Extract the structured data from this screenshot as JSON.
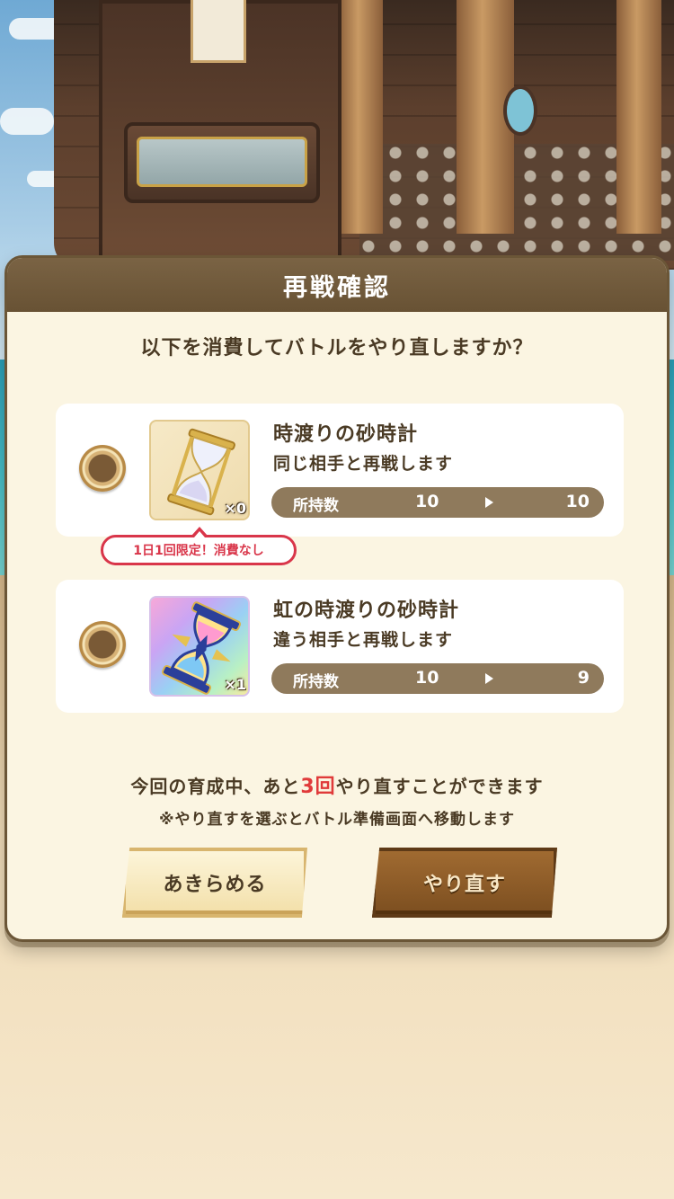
{
  "dialog": {
    "title": "再戦確認",
    "question": "以下を消費してバトルをやり直しますか？",
    "options": [
      {
        "name": "時渡りの砂時計",
        "description": "同じ相手と再戦します",
        "quantity": "×0",
        "owned_label": "所持数",
        "owned_before": "10",
        "owned_after": "10",
        "badge": "1日1回限定！消費なし",
        "icon": "hourglass-icon"
      },
      {
        "name": "虹の時渡りの砂時計",
        "description": "違う相手と再戦します",
        "quantity": "×1",
        "owned_label": "所持数",
        "owned_before": "10",
        "owned_after": "9",
        "icon": "rainbow-hourglass-icon"
      }
    ],
    "retry_info": {
      "prefix": "今回の育成中、あと",
      "count": "3回",
      "suffix": "やり直すことができます"
    },
    "note": "※やり直すを選ぶとバトル準備画面へ移動します",
    "buttons": {
      "give_up": "あきらめる",
      "retry": "やり直す"
    }
  },
  "colors": {
    "header": "#6f5a3c",
    "panel": "#fbf5e2",
    "accent_red": "#e03a3a",
    "owned_bar": "#8f7a5c"
  }
}
